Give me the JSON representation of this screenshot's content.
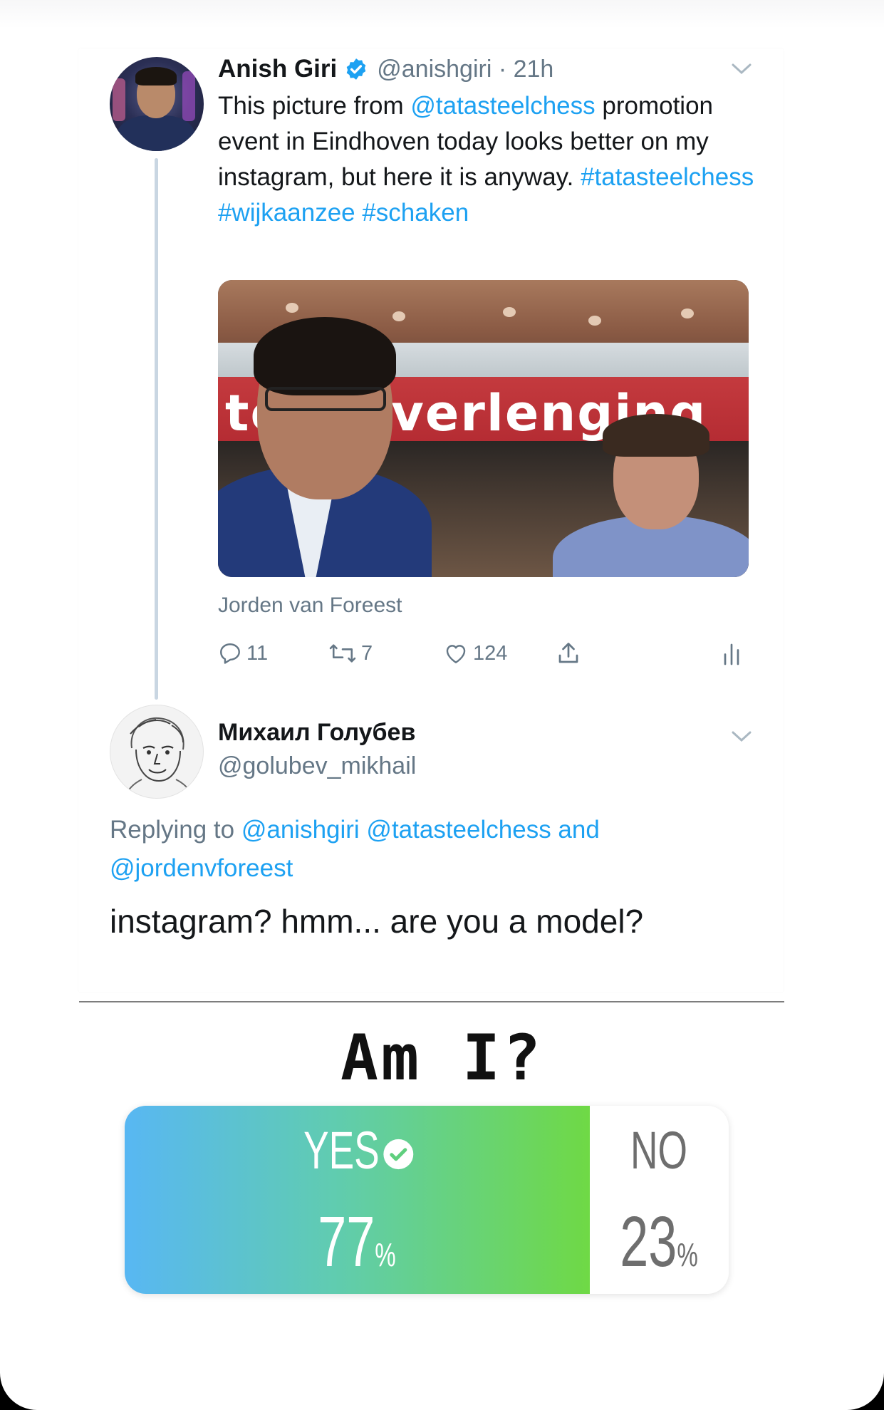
{
  "tweet": {
    "display_name": "Anish Giri",
    "handle_time": "@anishgiri · 21h",
    "text_pre": "This picture from ",
    "mention": "@tatasteelchess",
    "text_mid": " promotion event in Eindhoven today looks better on my instagram, but here  it is anyway. ",
    "hashtags": "#tatasteelchess #wijkaanzee #schaken",
    "photo_banner": "tc  de verlenging",
    "photo_credit": "Jorden van Foreest",
    "reply_count": "11",
    "retweet_count": "7",
    "like_count": "124"
  },
  "reply": {
    "display_name": "Михаил Голубев",
    "handle": "@golubev_mikhail",
    "replying_prefix": "Replying to ",
    "replying_mentions": "@anishgiri @tatasteelchess and @jordenvforeest",
    "text": "instagram? hmm... are you a model?"
  },
  "poll": {
    "question": "Am I?",
    "options": [
      {
        "label": "YES",
        "percent": "77",
        "percent_unit": "%",
        "selected": true
      },
      {
        "label": "NO",
        "percent": "23",
        "percent_unit": "%",
        "selected": false
      }
    ],
    "yes_fraction": 0.77
  },
  "colors": {
    "link": "#1da1f2",
    "muted": "#657786",
    "poll_gradient_start": "#58b7f3",
    "poll_gradient_end": "#6fd945"
  },
  "icons": [
    "verified-badge-icon",
    "chevron-down-icon",
    "reply-icon",
    "retweet-icon",
    "like-icon",
    "share-icon",
    "analytics-icon",
    "check-circle-icon"
  ]
}
